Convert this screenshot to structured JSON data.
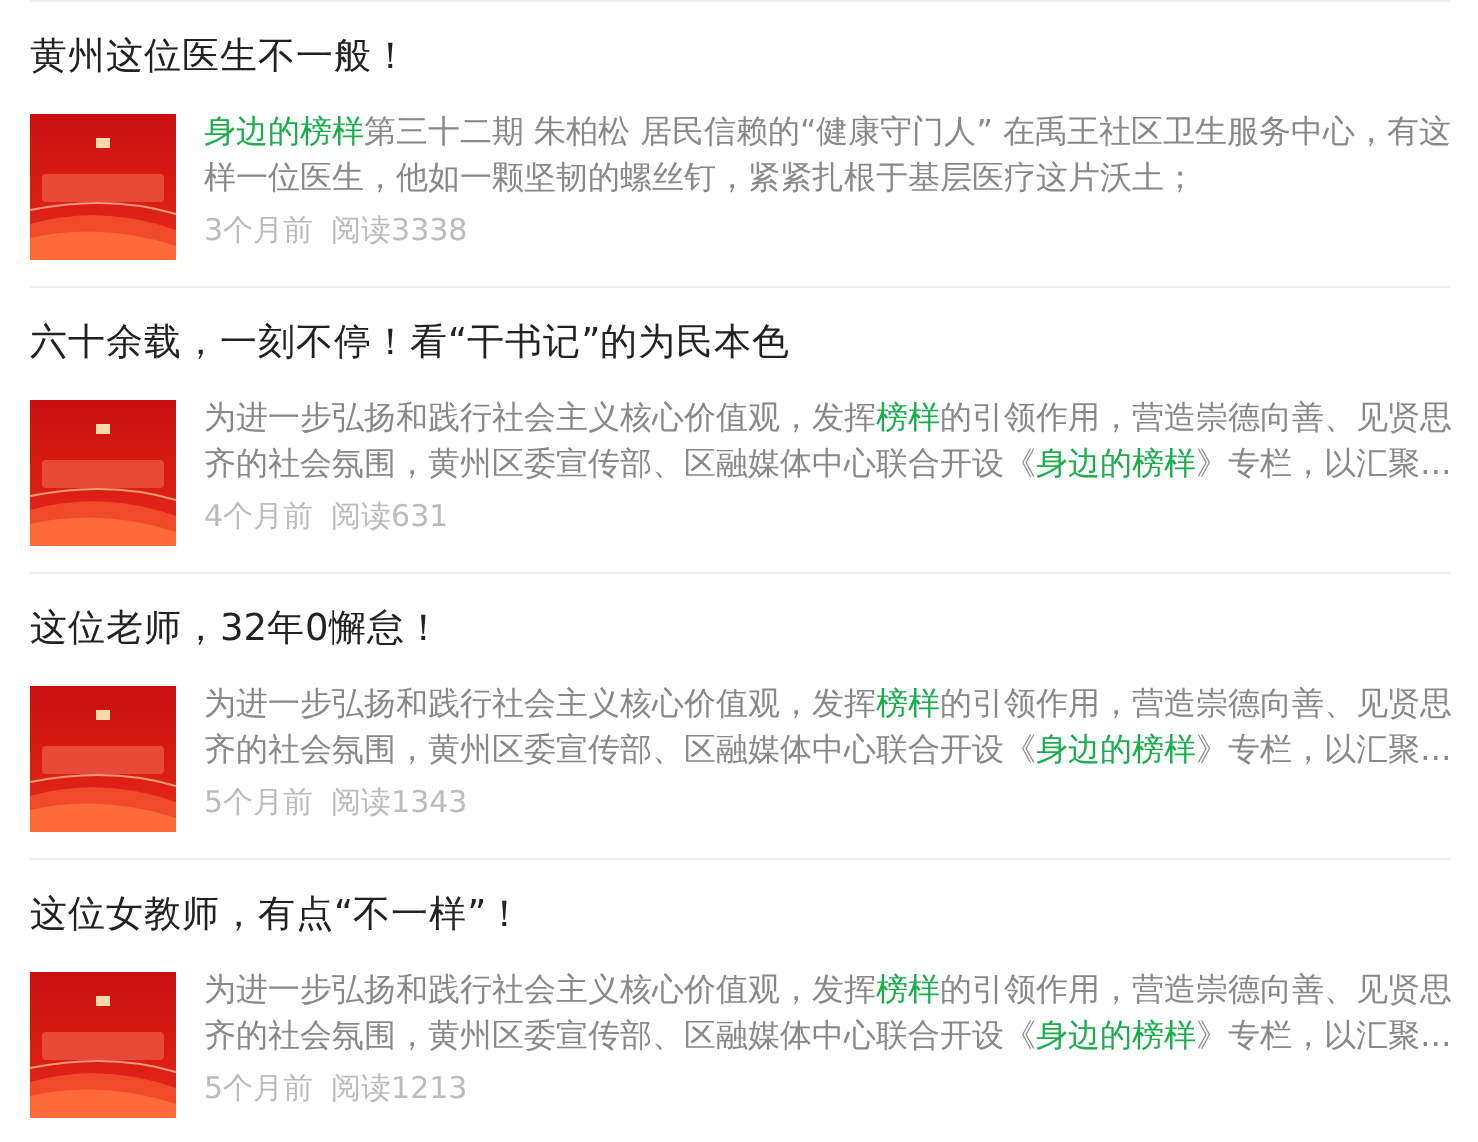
{
  "articles": [
    {
      "title": "黄州这位医生不一般！",
      "summary": [
        {
          "text": "身边的榜样",
          "highlight": true
        },
        {
          "text": "第三十二期 朱柏松 居民信赖的“健康守门人” 在禹王社区卫生服务中心，有这样一位医生，他如一颗坚韧的螺丝钉，紧紧扎根于基层医疗这片沃土；",
          "highlight": false
        }
      ],
      "time": "3个月前",
      "reads": "阅读3338"
    },
    {
      "title": "六十余载，一刻不停！看“干书记”的为民本色",
      "summary": [
        {
          "text": "为进一步弘扬和践行社会主义核心价值观，发挥",
          "highlight": false
        },
        {
          "text": "榜样",
          "highlight": true
        },
        {
          "text": "的引领作用，营造崇德向善、见贤思齐的社会氛围，黄州区委宣传部、区融媒体中心联合开设《",
          "highlight": false
        },
        {
          "text": "身边的榜样",
          "highlight": true
        },
        {
          "text": "》专栏，以汇聚…",
          "highlight": false
        }
      ],
      "time": "4个月前",
      "reads": "阅读631"
    },
    {
      "title": "这位老师，32年0懈怠！",
      "summary": [
        {
          "text": "为进一步弘扬和践行社会主义核心价值观，发挥",
          "highlight": false
        },
        {
          "text": "榜样",
          "highlight": true
        },
        {
          "text": "的引领作用，营造崇德向善、见贤思齐的社会氛围，黄州区委宣传部、区融媒体中心联合开设《",
          "highlight": false
        },
        {
          "text": "身边的榜样",
          "highlight": true
        },
        {
          "text": "》专栏，以汇聚…",
          "highlight": false
        }
      ],
      "time": "5个月前",
      "reads": "阅读1343"
    },
    {
      "title": "这位女教师，有点“不一样”！",
      "summary": [
        {
          "text": "为进一步弘扬和践行社会主义核心价值观，发挥",
          "highlight": false
        },
        {
          "text": "榜样",
          "highlight": true
        },
        {
          "text": "的引领作用，营造崇德向善、见贤思齐的社会氛围，黄州区委宣传部、区融媒体中心联合开设《",
          "highlight": false
        },
        {
          "text": "身边的榜样",
          "highlight": true
        },
        {
          "text": "》专栏，以汇聚…",
          "highlight": false
        }
      ],
      "time": "5个月前",
      "reads": "阅读1213"
    }
  ]
}
